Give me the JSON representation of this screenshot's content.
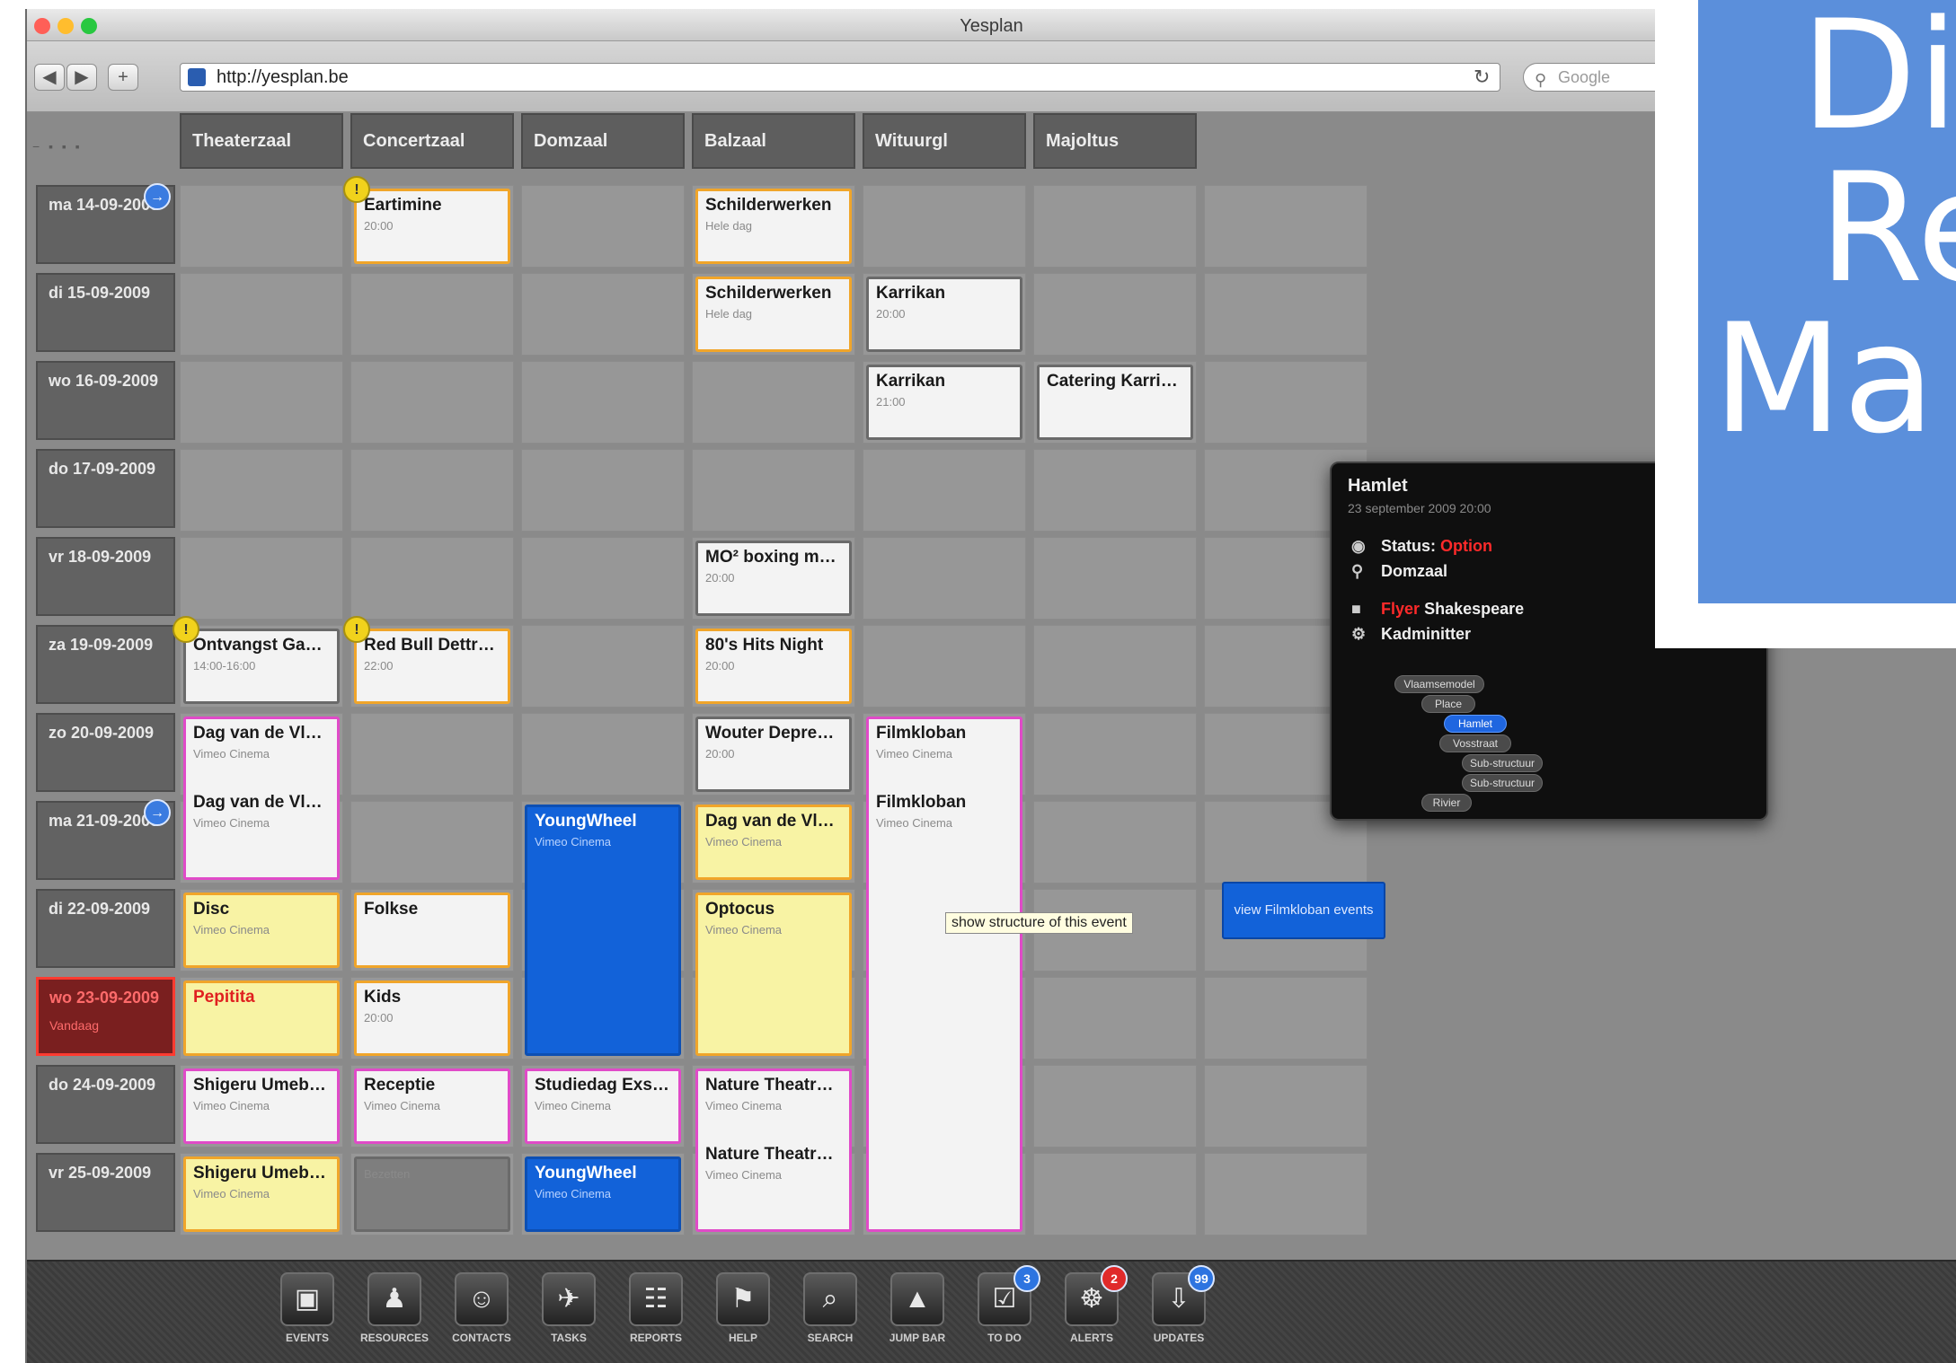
{
  "window": {
    "title": "Yesplan",
    "url": "http://yesplan.be",
    "search_placeholder": "Google"
  },
  "view_controls": "− ▪ ▪ ▪",
  "columns": [
    "Theaterzaal",
    "Concertzaal",
    "Domzaal",
    "Balzaal",
    "Wituurgl",
    "Majoltus"
  ],
  "dates": [
    {
      "label": "ma 14-09-2009",
      "sub": ""
    },
    {
      "label": "di 15-09-2009",
      "sub": ""
    },
    {
      "label": "wo 16-09-2009",
      "sub": ""
    },
    {
      "label": "do 17-09-2009",
      "sub": ""
    },
    {
      "label": "vr 18-09-2009",
      "sub": ""
    },
    {
      "label": "za 19-09-2009",
      "sub": ""
    },
    {
      "label": "zo 20-09-2009",
      "sub": ""
    },
    {
      "label": "ma 21-09-2009",
      "sub": ""
    },
    {
      "label": "di 22-09-2009",
      "sub": ""
    },
    {
      "label": "wo 23-09-2009",
      "sub": "Vandaag"
    },
    {
      "label": "do 24-09-2009",
      "sub": ""
    },
    {
      "label": "vr 25-09-2009",
      "sub": ""
    }
  ],
  "today_index": 9,
  "events": [
    {
      "title": "Eartimine",
      "sub": "20:00",
      "col": 1,
      "row": 0,
      "span": 1,
      "style": "orange",
      "badge": "yellow"
    },
    {
      "title": "Schilderwerken",
      "sub": "Hele dag",
      "col": 3,
      "row": 0,
      "span": 1,
      "style": "orange"
    },
    {
      "title": "Schilderwerken",
      "sub": "Hele dag",
      "col": 3,
      "row": 1,
      "span": 1,
      "style": "orange"
    },
    {
      "title": "Karrikan",
      "sub": "20:00",
      "col": 4,
      "row": 1,
      "span": 1,
      "style": "gray"
    },
    {
      "title": "Karrikan",
      "sub": "21:00",
      "col": 4,
      "row": 2,
      "span": 1,
      "style": "gray"
    },
    {
      "title": "Catering Karrikan",
      "sub": "",
      "col": 5,
      "row": 2,
      "span": 1,
      "style": "gray"
    },
    {
      "title": "MO² boxing met De...",
      "sub": "20:00",
      "col": 3,
      "row": 4,
      "span": 1,
      "style": "gray"
    },
    {
      "title": "Ontvangst Gast ...",
      "sub": "14:00-16:00",
      "col": 0,
      "row": 5,
      "span": 1,
      "style": "gray",
      "badge": "yellow"
    },
    {
      "title": "Red Bull Dettropedia",
      "sub": "22:00",
      "col": 1,
      "row": 5,
      "span": 1,
      "style": "orange",
      "badge": "yellow"
    },
    {
      "title": "80's Hits Night",
      "sub": "20:00",
      "col": 3,
      "row": 5,
      "span": 1,
      "style": "orange"
    },
    {
      "title": "Dag van de Vlaams...",
      "sub": "Vimeo Cinema",
      "col": 0,
      "row": 6,
      "span": 2,
      "style": "pink",
      "title2": "Dag van de Vlaams..."
    },
    {
      "title": "Wouter Deprez & F...",
      "sub": "20:00",
      "col": 3,
      "row": 6,
      "span": 1,
      "style": "gray"
    },
    {
      "title": "Filmkloban",
      "sub": "Vimeo Cinema",
      "col": 4,
      "row": 6,
      "span": 6,
      "style": "pink",
      "title2": "Filmkloban"
    },
    {
      "title": "YoungWheel",
      "sub": "Vimeo Cinema",
      "col": 2,
      "row": 7,
      "span": 3,
      "style": "blue"
    },
    {
      "title": "Dag van de Vlaams...",
      "sub": "Vimeo Cinema",
      "col": 3,
      "row": 7,
      "span": 1,
      "style": "yellow"
    },
    {
      "title": "Disc",
      "sub": "Vimeo Cinema",
      "col": 0,
      "row": 8,
      "span": 1,
      "style": "yellow"
    },
    {
      "title": "Folkse",
      "sub": "",
      "col": 1,
      "row": 8,
      "span": 1,
      "style": "orange"
    },
    {
      "title": "Optocus",
      "sub": "Vimeo Cinema",
      "col": 3,
      "row": 8,
      "span": 2,
      "style": "yellow"
    },
    {
      "title": "Pepitita",
      "sub": "",
      "col": 0,
      "row": 9,
      "span": 1,
      "style": "yellow-red"
    },
    {
      "title": "Kids",
      "sub": "20:00",
      "col": 1,
      "row": 9,
      "span": 1,
      "style": "orange"
    },
    {
      "title": "Shigeru Umebayashi",
      "sub": "Vimeo Cinema",
      "col": 0,
      "row": 10,
      "span": 1,
      "style": "pink"
    },
    {
      "title": "Receptie",
      "sub": "Vimeo Cinema",
      "col": 1,
      "row": 10,
      "span": 1,
      "style": "pink"
    },
    {
      "title": "Studiedag Exsibit...",
      "sub": "Vimeo Cinema",
      "col": 2,
      "row": 10,
      "span": 1,
      "style": "pink"
    },
    {
      "title": "Nature Theatre of ...",
      "sub": "Vimeo Cinema",
      "col": 3,
      "row": 10,
      "span": 2,
      "style": "pink",
      "title2": "Nature Theatre of ..."
    },
    {
      "title": "Shigeru Umebayashi",
      "sub": "Vimeo Cinema",
      "col": 0,
      "row": 11,
      "span": 1,
      "style": "yellow"
    },
    {
      "title": "",
      "sub": "Bezetten",
      "col": 1,
      "row": 11,
      "span": 1,
      "style": "dark"
    },
    {
      "title": "YoungWheel",
      "sub": "Vimeo Cinema",
      "col": 2,
      "row": 11,
      "span": 1,
      "style": "blue"
    }
  ],
  "popover": {
    "title": "Hamlet",
    "date": "23 september 2009 20:00",
    "status_label": "Status:",
    "status_value": "Option",
    "location": "Domzaal",
    "person_tag": "Flyer",
    "person_name": "Shakespeare",
    "sub_label": "Kadminitter",
    "tree": [
      "Vlaamsemodel",
      "Place",
      "Hamlet",
      "Vosstraat",
      "Sub-structuur",
      "Sub-structuur",
      "Rivier"
    ]
  },
  "tooltip": "show structure of this event",
  "view_button": "view Filmkloban events",
  "dock": [
    {
      "label": "EVENTS",
      "icon": "▣"
    },
    {
      "label": "RESOURCES",
      "icon": "♟"
    },
    {
      "label": "CONTACTS",
      "icon": "☺"
    },
    {
      "label": "TASKS",
      "icon": "✈"
    },
    {
      "label": "REPORTS",
      "icon": "☷"
    },
    {
      "label": "HELP",
      "icon": "⚑"
    },
    {
      "label": "SEARCH",
      "icon": "⌕"
    },
    {
      "label": "JUMP BAR",
      "icon": "▲"
    },
    {
      "label": "TO DO",
      "icon": "☑",
      "badge": "3"
    },
    {
      "label": "ALERTS",
      "icon": "☸",
      "badge": "2"
    },
    {
      "label": "UPDATES",
      "icon": "⇩",
      "badge": "99"
    }
  ],
  "banner": {
    "line1": "Di",
    "line2": "Re",
    "line3": "Ma"
  },
  "colors": {
    "accent_blue": "#1262d9",
    "today_red": "#ff3b30",
    "banner_blue": "#5b8fdb",
    "orange_border": "#f0a52a",
    "pink_border": "#e04bc8",
    "yellow_fill": "#f8f3a4"
  }
}
